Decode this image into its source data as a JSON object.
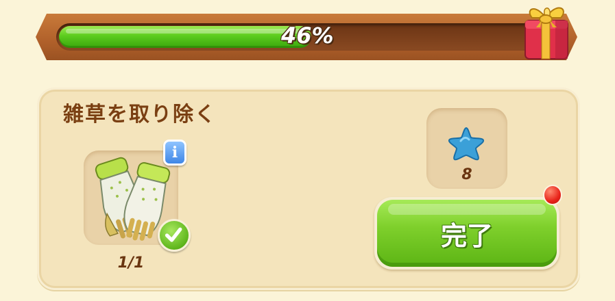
{
  "progress": {
    "percent_label": "46%",
    "fraction": 0.46
  },
  "task": {
    "title": "雑草を取り除く",
    "item": {
      "icon": "garden-gloves-icon",
      "count": "1/1",
      "completed": true
    },
    "reward": {
      "icon": "blue-star-icon",
      "amount": "8"
    },
    "complete_button_label": "完了"
  },
  "colors": {
    "progress_fill": "#5ccc1e",
    "frame": "#b0602a",
    "button_green": "#7fd02c",
    "title_brown": "#7a3f12",
    "notification_red": "#e8231a"
  }
}
